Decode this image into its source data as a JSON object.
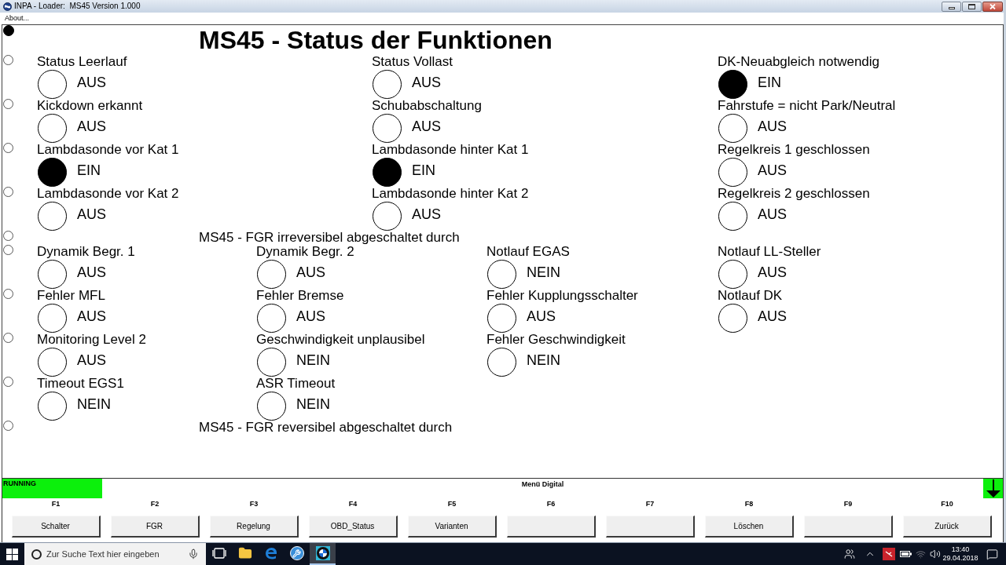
{
  "window": {
    "title": "INPA - Loader:  MS45 Version 1.000",
    "menu": [
      "About..."
    ]
  },
  "screen": {
    "sections": [
      {
        "kind": "title",
        "text": "MS45 - Status der Funktionen",
        "selected": true,
        "rows": [
          {
            "selected": false,
            "signals": [
              {
                "label": "Status Leerlauf",
                "value": "AUS",
                "on": false
              },
              {
                "label": "Status Vollast",
                "value": "AUS",
                "on": false
              },
              {
                "label": "DK-Neuabgleich notwendig",
                "value": "EIN",
                "on": true
              }
            ]
          },
          {
            "selected": false,
            "signals": [
              {
                "label": "Kickdown erkannt",
                "value": "AUS",
                "on": false
              },
              {
                "label": "Schubabschaltung",
                "value": "AUS",
                "on": false
              },
              {
                "label": "Fahrstufe = nicht Park/Neutral",
                "value": "AUS",
                "on": false
              }
            ]
          },
          {
            "selected": false,
            "signals": [
              {
                "label": "Lambdasonde vor Kat 1",
                "value": "EIN",
                "on": true
              },
              {
                "label": "Lambdasonde hinter Kat 1",
                "value": "EIN",
                "on": true
              },
              {
                "label": "Regelkreis 1 geschlossen",
                "value": "AUS",
                "on": false
              }
            ]
          },
          {
            "selected": false,
            "signals": [
              {
                "label": "Lambdasonde vor Kat 2",
                "value": "AUS",
                "on": false
              },
              {
                "label": "Lambdasonde hinter Kat 2",
                "value": "AUS",
                "on": false
              },
              {
                "label": "Regelkreis 2 geschlossen",
                "value": "AUS",
                "on": false
              }
            ]
          }
        ]
      },
      {
        "kind": "heading",
        "text": "MS45 - FGR irreversibel abgeschaltet durch",
        "selected": false,
        "rows": [
          {
            "selected": false,
            "signals": [
              {
                "label": "Dynamik Begr. 1",
                "value": "AUS",
                "on": false
              },
              {
                "label": "Dynamik Begr. 2",
                "value": "AUS",
                "on": false
              },
              {
                "label": "Notlauf EGAS",
                "value": "NEIN",
                "on": false
              },
              {
                "label": "Notlauf LL-Steller",
                "value": "AUS",
                "on": false
              }
            ]
          },
          {
            "selected": false,
            "signals": [
              {
                "label": "Fehler MFL",
                "value": "AUS",
                "on": false
              },
              {
                "label": "Fehler Bremse",
                "value": "AUS",
                "on": false
              },
              {
                "label": "Fehler Kupplungsschalter",
                "value": "AUS",
                "on": false
              },
              {
                "label": "Notlauf DK",
                "value": "AUS",
                "on": false
              }
            ]
          },
          {
            "selected": false,
            "signals": [
              {
                "label": "Monitoring Level 2",
                "value": "AUS",
                "on": false
              },
              {
                "label": "Geschwindigkeit unplausibel",
                "value": "NEIN",
                "on": false
              },
              {
                "label": "Fehler Geschwindigkeit",
                "value": "NEIN",
                "on": false
              }
            ]
          },
          {
            "selected": false,
            "signals": [
              {
                "label": "Timeout EGS1",
                "value": "NEIN",
                "on": false
              },
              {
                "label": "ASR Timeout",
                "value": "NEIN",
                "on": false
              }
            ]
          }
        ]
      },
      {
        "kind": "heading",
        "text": "MS45 - FGR reversibel abgeschaltet durch",
        "selected": false
      }
    ]
  },
  "status_bar": {
    "state": "RUNNING",
    "menu": "Menü Digital"
  },
  "function_keys": [
    {
      "key": "F1",
      "label": "Schalter"
    },
    {
      "key": "F2",
      "label": "FGR"
    },
    {
      "key": "F3",
      "label": "Regelung"
    },
    {
      "key": "F4",
      "label": "OBD_Status"
    },
    {
      "key": "F5",
      "label": "Varianten"
    },
    {
      "key": "F6"
    },
    {
      "key": "F7"
    },
    {
      "key": "F8",
      "label": "Löschen"
    },
    {
      "key": "F9"
    },
    {
      "key": "F10",
      "label": "Zurück"
    }
  ],
  "taskbar": {
    "search": {
      "placeholder": "Zur Suche Text hier eingeben"
    },
    "apps": [
      {
        "kind": "tasks",
        "selected": false
      },
      {
        "kind": "folder",
        "selected": false
      },
      {
        "kind": "browser",
        "selected": false
      },
      {
        "kind": "wrench",
        "selected": false
      },
      {
        "kind": "emblem",
        "selected": true
      }
    ],
    "clock": {
      "time": "13:40",
      "date": "29.04.2018"
    }
  }
}
